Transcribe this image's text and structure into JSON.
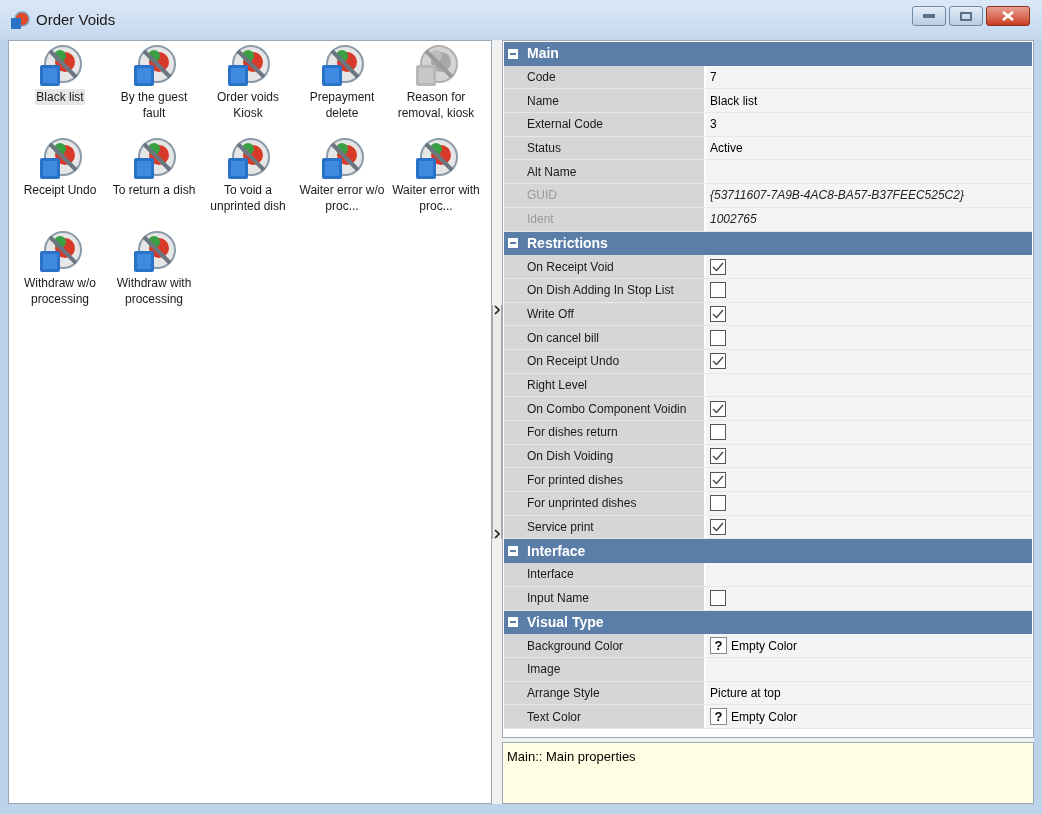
{
  "window": {
    "title": "Order Voids"
  },
  "items": [
    {
      "label": "Black list",
      "selected": true,
      "disabled": false
    },
    {
      "label": "By the guest fault",
      "selected": false,
      "disabled": false
    },
    {
      "label": "Order voids Kiosk",
      "selected": false,
      "disabled": false
    },
    {
      "label": "Prepayment delete",
      "selected": false,
      "disabled": false
    },
    {
      "label": "Reason for removal, kiosk",
      "selected": false,
      "disabled": true
    },
    {
      "label": "Receipt Undo",
      "selected": false,
      "disabled": false
    },
    {
      "label": "To return a dish",
      "selected": false,
      "disabled": false
    },
    {
      "label": "To void a unprinted dish",
      "selected": false,
      "disabled": false
    },
    {
      "label": "Waiter error w/o proc...",
      "selected": false,
      "disabled": false
    },
    {
      "label": "Waiter error with proc...",
      "selected": false,
      "disabled": false
    },
    {
      "label": "Withdraw w/o processing",
      "selected": false,
      "disabled": false
    },
    {
      "label": "Withdraw with processing",
      "selected": false,
      "disabled": false
    }
  ],
  "sections": [
    {
      "title": "Main",
      "expanded": true,
      "rows": [
        {
          "kind": "text",
          "label": "Code",
          "value": "7",
          "disabled": false
        },
        {
          "kind": "text",
          "label": "Name",
          "value": "Black list",
          "disabled": false
        },
        {
          "kind": "text",
          "label": "External Code",
          "value": "3",
          "disabled": false
        },
        {
          "kind": "text",
          "label": "Status",
          "value": "Active",
          "disabled": false
        },
        {
          "kind": "text",
          "label": "Alt Name",
          "disabled": false
        },
        {
          "kind": "text",
          "label": "GUID",
          "value": "{53711607-7A9B-4AC8-BA57-B37FEEC525C2}",
          "disabled": true
        },
        {
          "kind": "text",
          "label": "Ident",
          "value": "1002765",
          "disabled": true
        }
      ]
    },
    {
      "title": "Restrictions",
      "expanded": true,
      "rows": [
        {
          "kind": "check",
          "label": "On Receipt Void",
          "checked": true
        },
        {
          "kind": "check",
          "label": "On Dish Adding In Stop List",
          "checked": false
        },
        {
          "kind": "check",
          "label": "Write Off",
          "checked": true
        },
        {
          "kind": "check",
          "label": "On cancel bill",
          "checked": false
        },
        {
          "kind": "check",
          "label": "On Receipt Undo",
          "checked": true
        },
        {
          "kind": "text",
          "label": "Right Level"
        },
        {
          "kind": "check",
          "label": "On Combo Component Voidin",
          "checked": true
        },
        {
          "kind": "check",
          "label": "For dishes return",
          "checked": false
        },
        {
          "kind": "check",
          "label": "On Dish Voiding",
          "checked": true
        },
        {
          "kind": "check",
          "label": "For printed dishes",
          "checked": true
        },
        {
          "kind": "check",
          "label": "For unprinted dishes",
          "checked": false
        },
        {
          "kind": "check",
          "label": "Service print",
          "checked": true
        }
      ]
    },
    {
      "title": "Interface",
      "expanded": true,
      "rows": [
        {
          "kind": "text",
          "label": "Interface"
        },
        {
          "kind": "check",
          "label": "Input Name",
          "checked": false
        }
      ]
    },
    {
      "title": "Visual Type",
      "expanded": true,
      "rows": [
        {
          "kind": "color",
          "label": "Background Color",
          "badge": "?",
          "value": "Empty Color"
        },
        {
          "kind": "text",
          "label": "Image"
        },
        {
          "kind": "text",
          "label": "Arrange Style",
          "value": "Picture at top"
        },
        {
          "kind": "color",
          "label": "Text Color",
          "badge": "?",
          "value": "Empty Color"
        }
      ]
    }
  ],
  "description": "Main:: Main properties"
}
